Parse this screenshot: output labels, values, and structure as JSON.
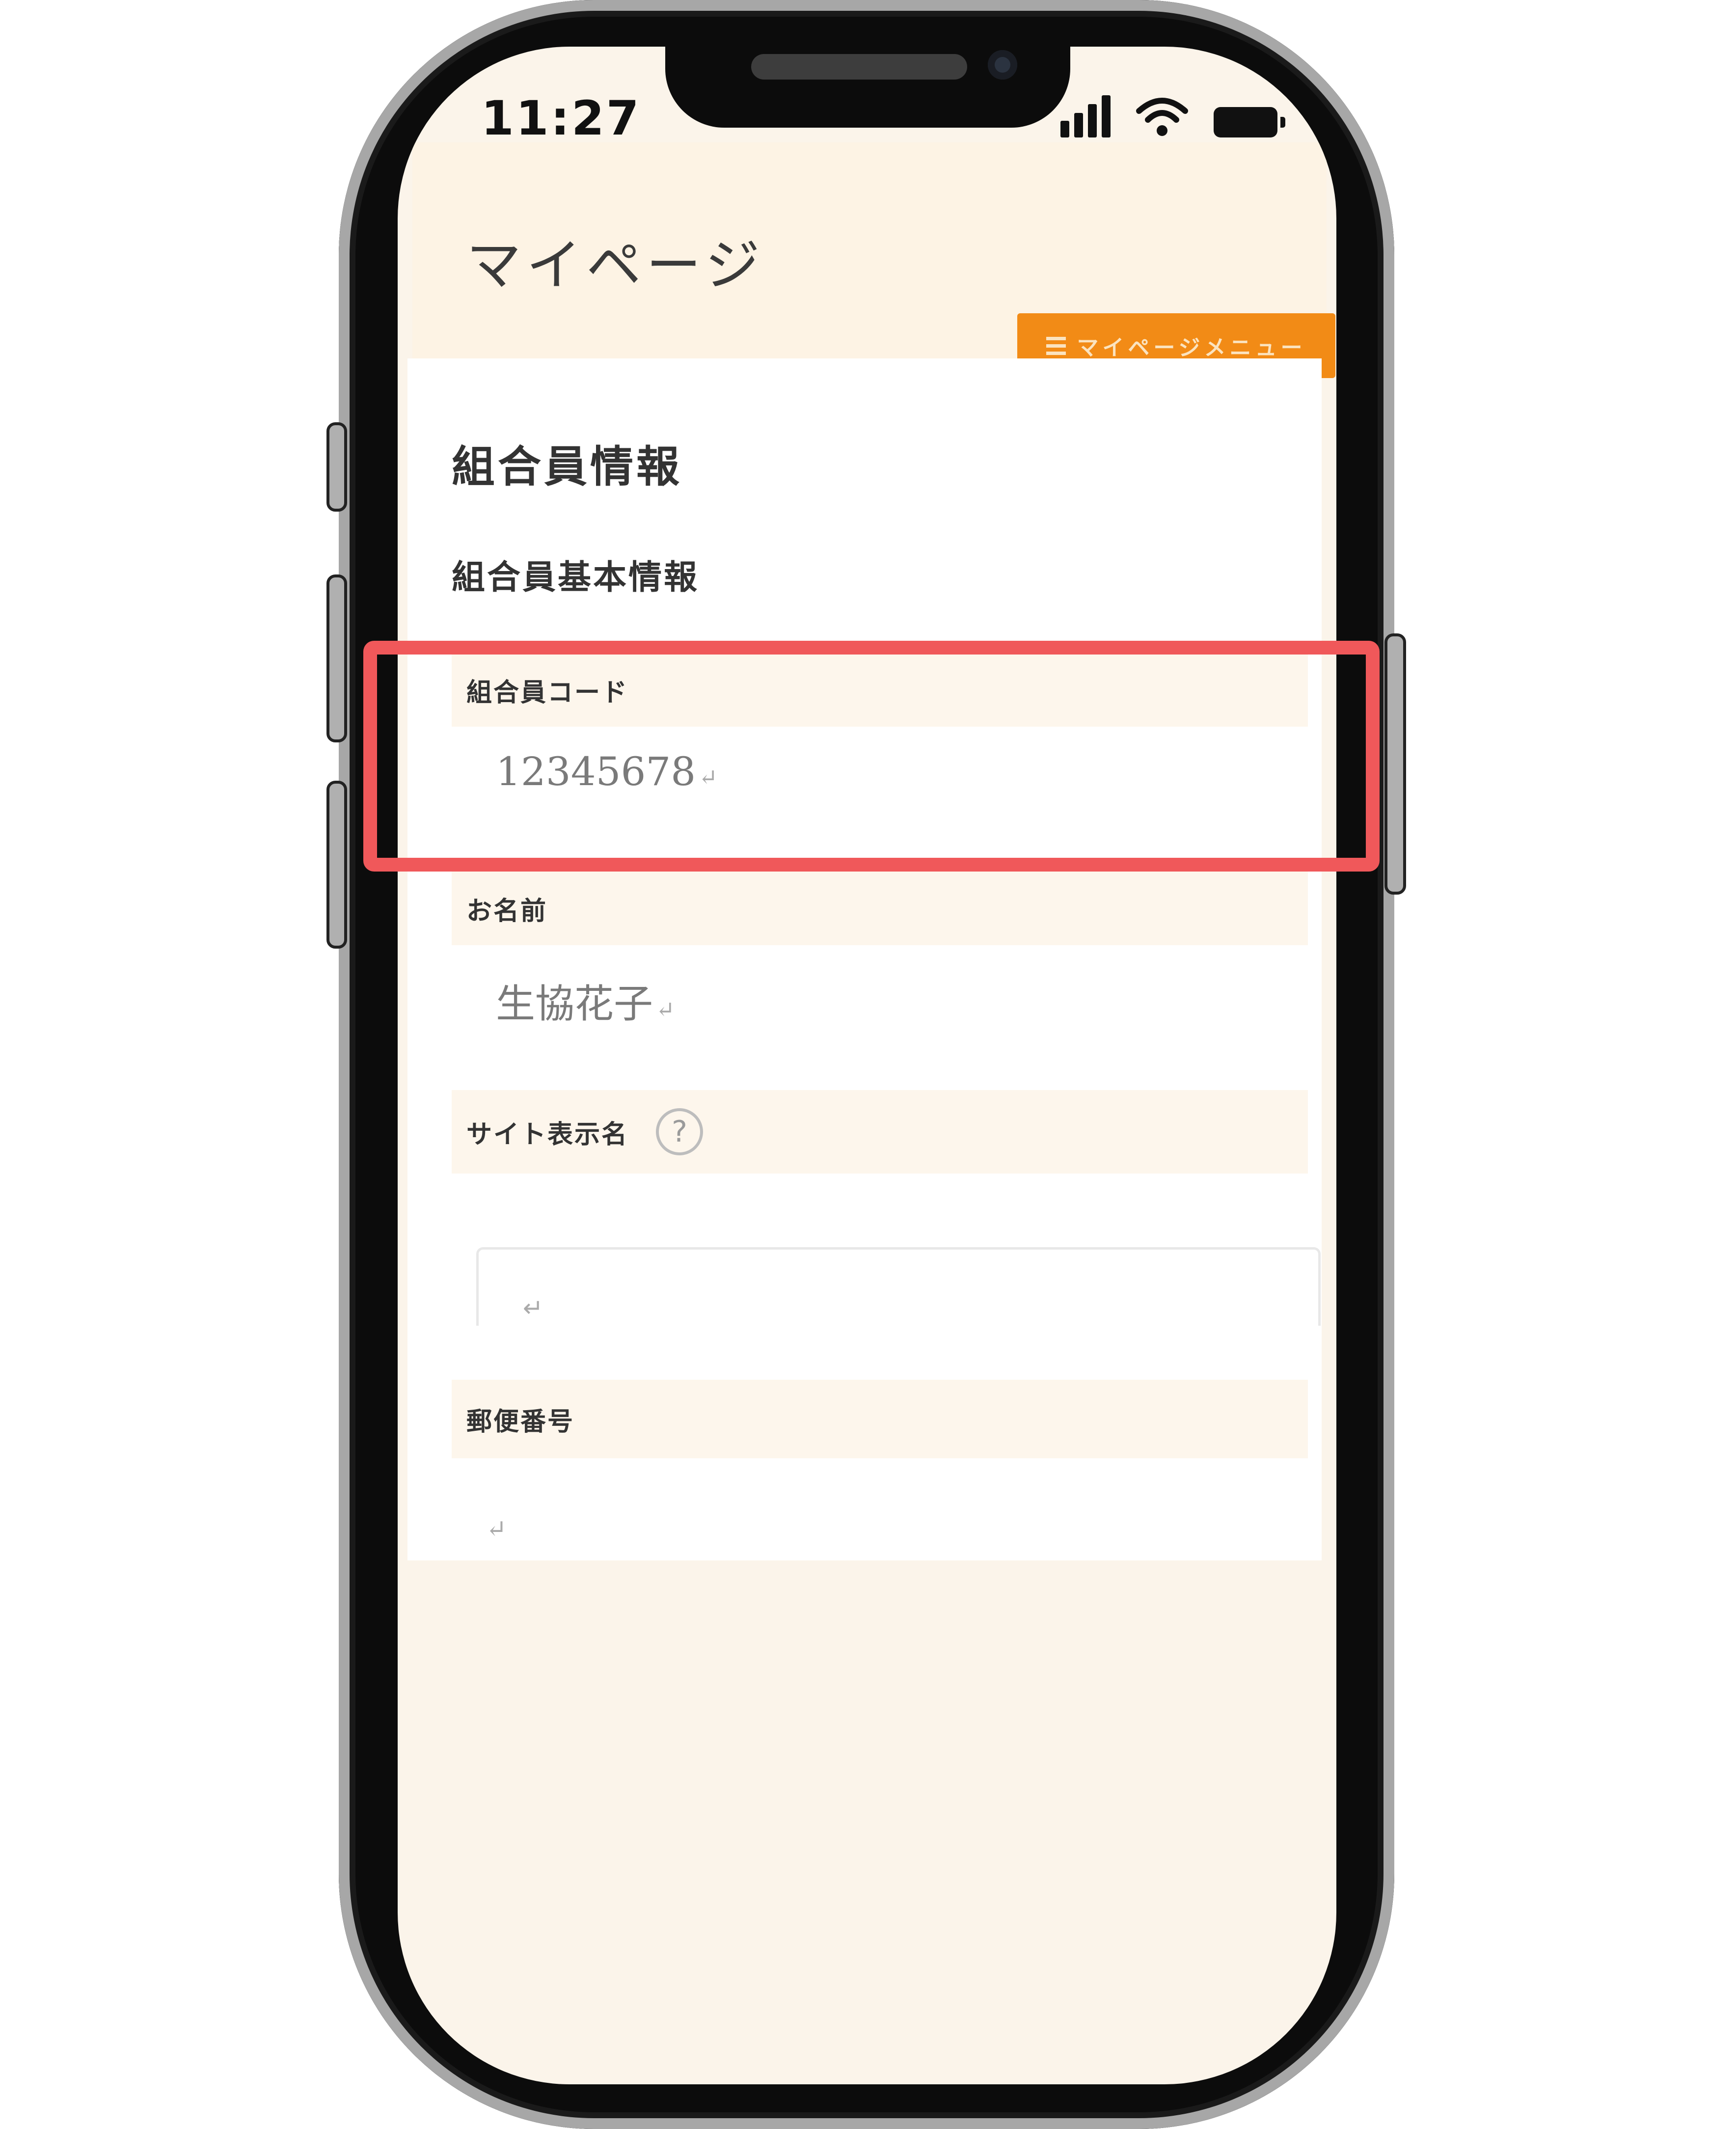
{
  "status_bar": {
    "time": "11:27"
  },
  "header": {
    "title": "マイページ",
    "menu_button_label": "マイページメニュー"
  },
  "content": {
    "section_title": "組合員情報",
    "subsection_title": "組合員基本情報",
    "fields": [
      {
        "label": "組合員コード",
        "value": "12345678",
        "highlighted": true
      },
      {
        "label": "お名前",
        "value": "生協花子"
      },
      {
        "label": "サイト表示名",
        "value": "",
        "help_icon": "question-circle-icon",
        "help_glyph": "?"
      },
      {
        "label": "郵便番号",
        "value": ""
      }
    ],
    "return_glyph": "↵"
  },
  "colors": {
    "accent": "#f28b16",
    "header_bg": "#fdf3e4",
    "highlight": "#f0585a"
  }
}
